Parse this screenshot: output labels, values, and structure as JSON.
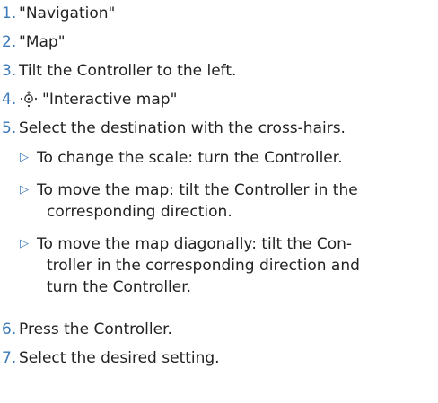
{
  "colors": {
    "number": "#3d7ab8",
    "text": "#222222",
    "arrow": "#3d7ab8"
  },
  "steps": [
    {
      "number": "1.",
      "text": "\"Navigation\""
    },
    {
      "number": "2.",
      "text": "\"Map\""
    },
    {
      "number": "3.",
      "text": "Tilt the Controller to the left."
    },
    {
      "number": "4.",
      "icon": "controller-move-icon",
      "text": "\"Interactive map\""
    },
    {
      "number": "5.",
      "text": "Select the destination with the cross-hairs."
    },
    {
      "number": "6.",
      "text": "Press the Controller."
    },
    {
      "number": "7.",
      "text": "Select the desired setting."
    }
  ],
  "substeps": [
    {
      "arrow": "▷",
      "lines": [
        "To change the scale: turn the Controller."
      ]
    },
    {
      "arrow": "▷",
      "lines": [
        "To move the map: tilt the Controller in the",
        "corresponding direction."
      ]
    },
    {
      "arrow": "▷",
      "lines": [
        "To move the map diagonally: tilt the Con-",
        "troller in the corresponding direction and",
        "turn the Controller."
      ]
    }
  ]
}
